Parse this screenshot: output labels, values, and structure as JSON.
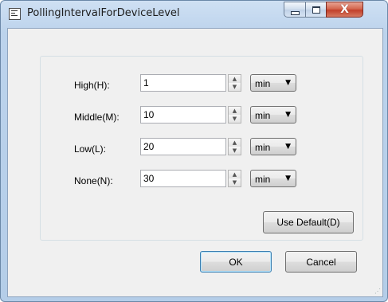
{
  "window": {
    "title": "PollingIntervalForDeviceLevel",
    "icon": "window-app-icon",
    "controls": {
      "minimize": "minimize-icon",
      "maximize": "maximize-icon",
      "close": "X"
    }
  },
  "rows": [
    {
      "label": "High(H):",
      "value": "1",
      "unit": "min"
    },
    {
      "label": "Middle(M):",
      "value": "10",
      "unit": "min"
    },
    {
      "label": "Low(L):",
      "value": "20",
      "unit": "min"
    },
    {
      "label": "None(N):",
      "value": "30",
      "unit": "min"
    }
  ],
  "buttons": {
    "use_default": "Use Default(D)",
    "ok": "OK",
    "cancel": "Cancel"
  }
}
